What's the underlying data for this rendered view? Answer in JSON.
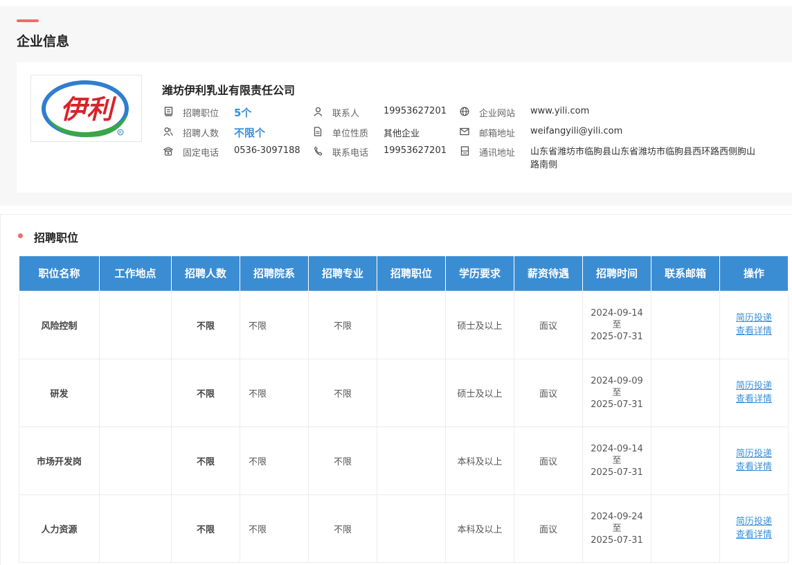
{
  "company_section": {
    "title": "企业信息",
    "company_name": "潍坊伊利乳业有限责任公司",
    "logo_text": "伊利",
    "fields": {
      "positions": {
        "label": "招聘职位",
        "value": "5个"
      },
      "headcount": {
        "label": "招聘人数",
        "value": "不限个"
      },
      "landline": {
        "label": "固定电话",
        "value": "0536-3097188"
      },
      "contact": {
        "label": "联系人",
        "value": "19953627201"
      },
      "unit_type": {
        "label": "单位性质",
        "value": "其他企业"
      },
      "contact_phone": {
        "label": "联系电话",
        "value": "19953627201"
      },
      "website": {
        "label": "企业网站",
        "value": "www.yili.com"
      },
      "email": {
        "label": "邮箱地址",
        "value": "weifangyili@yili.com"
      },
      "address": {
        "label": "通讯地址",
        "value": "山东省潍坊市临朐县山东省潍坊市临朐县西环路西侧朐山路南侧"
      }
    },
    "accent_color": "#f06a6a",
    "link_color": "#3a8fd8"
  },
  "jobs_section": {
    "title": "招聘职位",
    "header_color": "#3b8dd3",
    "columns": [
      "职位名称",
      "工作地点",
      "招聘人数",
      "招聘院系",
      "招聘专业",
      "招聘职位",
      "学历要求",
      "薪资待遇",
      "招聘时间",
      "联系邮箱",
      "操作"
    ],
    "rows": [
      {
        "name": "风险控制",
        "location": "",
        "count": "不限",
        "department": "不限",
        "major": "不限",
        "position": "",
        "education": "硕士及以上",
        "salary": "面议",
        "start": "2024-09-14",
        "to": "至",
        "end": "2025-07-31",
        "email": "",
        "action_apply": "简历投递",
        "action_detail": "查看详情"
      },
      {
        "name": "研发",
        "location": "",
        "count": "不限",
        "department": "不限",
        "major": "不限",
        "position": "",
        "education": "硕士及以上",
        "salary": "面议",
        "start": "2024-09-09",
        "to": "至",
        "end": "2025-07-31",
        "email": "",
        "action_apply": "简历投递",
        "action_detail": "查看详情"
      },
      {
        "name": "市场开发岗",
        "location": "",
        "count": "不限",
        "department": "不限",
        "major": "不限",
        "position": "",
        "education": "本科及以上",
        "salary": "面议",
        "start": "2024-09-14",
        "to": "至",
        "end": "2025-07-31",
        "email": "",
        "action_apply": "简历投递",
        "action_detail": "查看详情"
      },
      {
        "name": "人力资源",
        "location": "",
        "count": "不限",
        "department": "不限",
        "major": "不限",
        "position": "",
        "education": "本科及以上",
        "salary": "面议",
        "start": "2024-09-24",
        "to": "至",
        "end": "2025-07-31",
        "email": "",
        "action_apply": "简历投递",
        "action_detail": "查看详情"
      }
    ]
  }
}
